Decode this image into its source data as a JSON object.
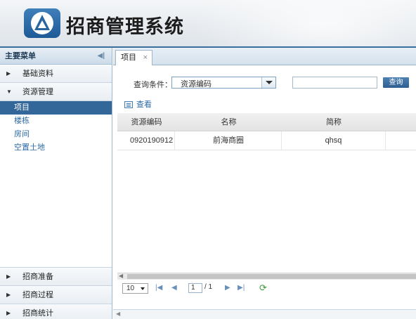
{
  "header": {
    "app_title": "招商管理系统",
    "logo": "triangle-logo-icon"
  },
  "sidebar": {
    "title": "主要菜单",
    "groups_top": [
      {
        "label": "基础资料",
        "expanded": false
      },
      {
        "label": "资源管理",
        "expanded": true
      }
    ],
    "sub_items": [
      {
        "label": "项目",
        "active": true
      },
      {
        "label": "楼栋",
        "active": false
      },
      {
        "label": "房间",
        "active": false
      },
      {
        "label": "空置土地",
        "active": false
      }
    ],
    "groups_bottom": [
      {
        "label": "招商准备"
      },
      {
        "label": "招商过程"
      },
      {
        "label": "招商统计"
      }
    ]
  },
  "tabs": [
    {
      "label": "项目",
      "close": "×"
    }
  ],
  "query": {
    "label": "查询条件：",
    "field_value": "资源编码",
    "input_value": "",
    "button_label": "查询"
  },
  "toolbar": {
    "view_label": "查看"
  },
  "grid": {
    "columns": [
      "资源编码",
      "名称",
      "简称"
    ],
    "rows": [
      [
        "0920190912",
        "前海商圈",
        "qhsq"
      ]
    ]
  },
  "pager": {
    "page_size": "10",
    "current_page": "1",
    "total_text": "/ 1"
  },
  "colors": {
    "accent": "#336699",
    "header_border": "#3a6f9d"
  }
}
